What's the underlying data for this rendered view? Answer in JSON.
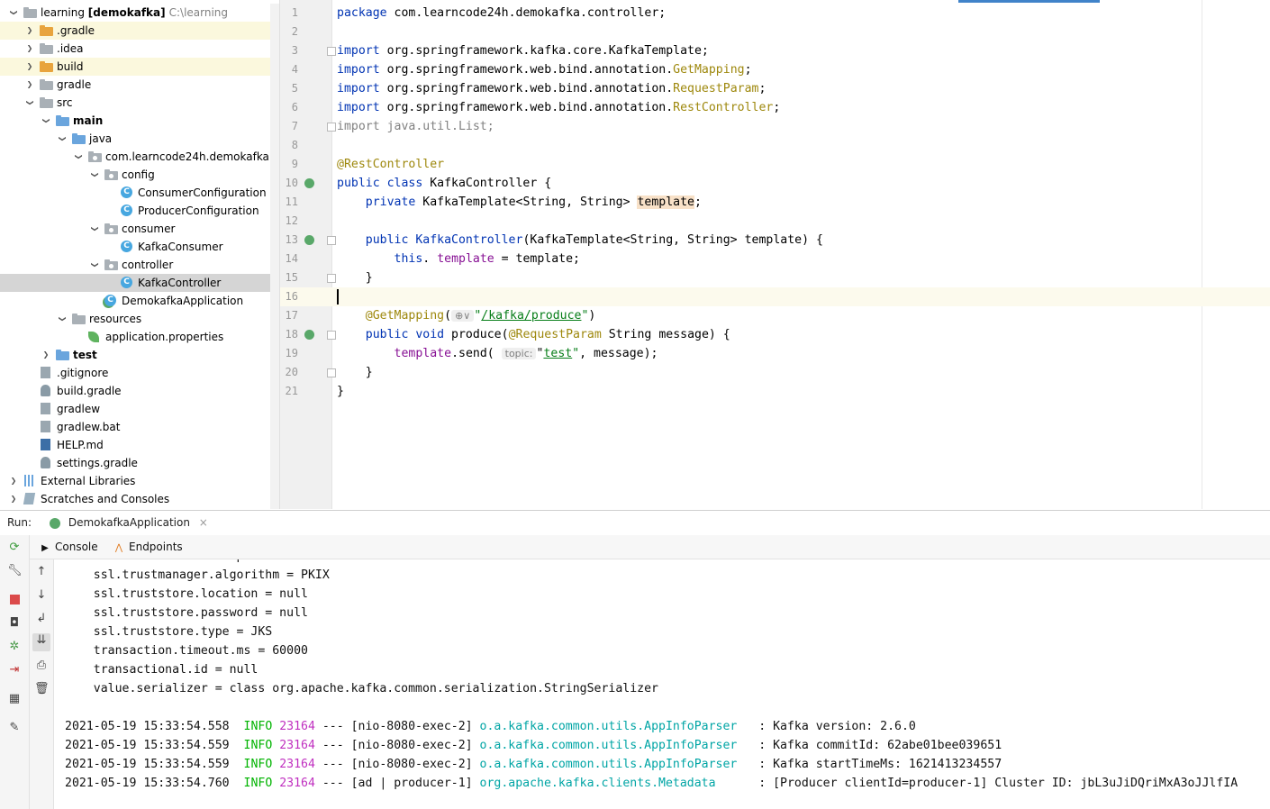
{
  "project_tree": {
    "items": [
      {
        "label": "learning [demokafka]",
        "extra": "C:\\learning",
        "icon": "module-folder-icon",
        "bold_part": true
      },
      {
        "label": ".gradle",
        "icon": "folder-icon"
      },
      {
        "label": ".idea",
        "icon": "folder-icon"
      },
      {
        "label": "build",
        "icon": "folder-icon"
      },
      {
        "label": "gradle",
        "icon": "folder-icon"
      },
      {
        "label": "src",
        "icon": "folder-icon"
      },
      {
        "label": "main",
        "icon": "source-folder-icon"
      },
      {
        "label": "java",
        "icon": "source-folder-icon"
      },
      {
        "label": "com.learncode24h.demokafka",
        "icon": "package-icon"
      },
      {
        "label": "config",
        "icon": "package-icon"
      },
      {
        "label": "ConsumerConfiguration",
        "icon": "class-icon"
      },
      {
        "label": "ProducerConfiguration",
        "icon": "class-icon"
      },
      {
        "label": "consumer",
        "icon": "package-icon"
      },
      {
        "label": "KafkaConsumer",
        "icon": "class-icon"
      },
      {
        "label": "controller",
        "icon": "package-icon"
      },
      {
        "label": "KafkaController",
        "icon": "class-icon"
      },
      {
        "label": "DemokafkaApplication",
        "icon": "spring-boot-class-icon"
      },
      {
        "label": "resources",
        "icon": "resources-folder-icon"
      },
      {
        "label": "application.properties",
        "icon": "spring-properties-icon"
      },
      {
        "label": "test",
        "icon": "source-folder-icon"
      },
      {
        "label": ".gitignore",
        "icon": "gitignore-icon"
      },
      {
        "label": "build.gradle",
        "icon": "gradle-icon"
      },
      {
        "label": "gradlew",
        "icon": "script-file-icon"
      },
      {
        "label": "gradlew.bat",
        "icon": "bat-file-icon"
      },
      {
        "label": "HELP.md",
        "icon": "markdown-icon"
      },
      {
        "label": "settings.gradle",
        "icon": "gradle-icon"
      },
      {
        "label": "External Libraries",
        "icon": "libraries-icon"
      },
      {
        "label": "Scratches and Consoles",
        "icon": "scratches-icon"
      }
    ]
  },
  "editor": {
    "lines": [
      {
        "n": "1",
        "segs": [
          [
            "kw",
            "package"
          ],
          [
            "",
            "com.learncode24h.demokafka.controller;"
          ]
        ]
      },
      {
        "n": "2",
        "segs": []
      },
      {
        "n": "3",
        "segs": [
          [
            "kw",
            "import"
          ],
          [
            "",
            "org.springframework.kafka.core.KafkaTemplate;"
          ]
        ]
      },
      {
        "n": "4",
        "segs": [
          [
            "kw",
            "import"
          ],
          [
            "",
            "org.springframework.web.bind.annotation."
          ],
          [
            "ann",
            "GetMapping"
          ],
          [
            "",
            ";"
          ]
        ]
      },
      {
        "n": "5",
        "segs": [
          [
            "kw",
            "import"
          ],
          [
            "",
            "org.springframework.web.bind.annotation."
          ],
          [
            "ann",
            "RequestParam"
          ],
          [
            "",
            ";"
          ]
        ]
      },
      {
        "n": "6",
        "segs": [
          [
            "kw",
            "import"
          ],
          [
            "",
            "org.springframework.web.bind.annotation."
          ],
          [
            "ann",
            "RestController"
          ],
          [
            "",
            ";"
          ]
        ]
      },
      {
        "n": "7",
        "segs": [
          [
            "grey",
            "import"
          ],
          [
            "grey",
            "java.util.List;"
          ]
        ]
      },
      {
        "n": "8",
        "segs": []
      },
      {
        "n": "9",
        "segs": [
          [
            "ann",
            "@RestController"
          ]
        ]
      },
      {
        "n": "10",
        "segs": [
          [
            "kw",
            "public class"
          ],
          [
            "",
            "KafkaController {"
          ]
        ]
      },
      {
        "n": "11",
        "segs": [
          [
            "",
            "    "
          ],
          [
            "kw",
            "private"
          ],
          [
            "",
            "KafkaTemplate<String, String> "
          ],
          [
            "hl",
            "template"
          ],
          [
            "",
            ";"
          ]
        ]
      },
      {
        "n": "12",
        "segs": []
      },
      {
        "n": "13",
        "segs": [
          [
            "",
            "    "
          ],
          [
            "kw",
            "public"
          ],
          [
            "kw",
            "KafkaController"
          ],
          [
            "",
            "(KafkaTemplate<String, String> template) {"
          ]
        ]
      },
      {
        "n": "14",
        "segs": [
          [
            "",
            "        "
          ],
          [
            "kw",
            "this"
          ],
          [
            "",
            ". "
          ],
          [
            "fld",
            "template"
          ],
          [
            "",
            " = template;"
          ]
        ]
      },
      {
        "n": "15",
        "segs": [
          [
            "",
            "    }"
          ]
        ]
      },
      {
        "n": "16",
        "segs": [
          [
            "caret",
            ""
          ]
        ]
      },
      {
        "n": "17",
        "segs": [
          [
            "",
            "    "
          ],
          [
            "ann",
            "@GetMapping"
          ],
          [
            "",
            "("
          ],
          [
            "hint",
            "⊕∨"
          ],
          [
            "str",
            "\""
          ],
          [
            "strl",
            "/kafka/produce"
          ],
          [
            "str",
            "\""
          ],
          [
            "",
            ")"
          ]
        ]
      },
      {
        "n": "18",
        "segs": [
          [
            "",
            "    "
          ],
          [
            "kw",
            "public void"
          ],
          [
            "",
            "produce("
          ],
          [
            "ann",
            "@RequestParam"
          ],
          [
            "",
            " String message) {"
          ]
        ]
      },
      {
        "n": "19",
        "segs": [
          [
            "",
            "        "
          ],
          [
            "fld",
            "template"
          ],
          [
            "",
            ".send( "
          ],
          [
            "hint",
            "topic:"
          ],
          [
            "",
            "\""
          ],
          [
            "strl",
            "test"
          ],
          [
            "str",
            "\""
          ],
          [
            "",
            ", message);"
          ]
        ]
      },
      {
        "n": "20",
        "segs": [
          [
            "",
            "    }"
          ]
        ]
      },
      {
        "n": "21",
        "segs": [
          [
            "",
            "}"
          ]
        ]
      }
    ]
  },
  "run": {
    "label": "Run:",
    "tab": "DemokafkaApplication",
    "console_tab": "Console",
    "endpoints_tab": "Endpoints"
  },
  "console": {
    "partial_top": "    ssl.secure.random.implementation = null",
    "config_lines": [
      "    ssl.trustmanager.algorithm = PKIX",
      "    ssl.truststore.location = null",
      "    ssl.truststore.password = null",
      "    ssl.truststore.type = JKS",
      "    transaction.timeout.ms = 60000",
      "    transactional.id = null",
      "    value.serializer = class org.apache.kafka.common.serialization.StringSerializer"
    ],
    "log_lines": [
      {
        "ts": "2021-05-19 15:33:54.558",
        "level": "INFO",
        "pid": "23164",
        "sep": "---",
        "thread": "[nio-8080-exec-2]",
        "logger": "o.a.kafka.common.utils.AppInfoParser",
        "msg": ": Kafka version: 2.6.0"
      },
      {
        "ts": "2021-05-19 15:33:54.559",
        "level": "INFO",
        "pid": "23164",
        "sep": "---",
        "thread": "[nio-8080-exec-2]",
        "logger": "o.a.kafka.common.utils.AppInfoParser",
        "msg": ": Kafka commitId: 62abe01bee039651"
      },
      {
        "ts": "2021-05-19 15:33:54.559",
        "level": "INFO",
        "pid": "23164",
        "sep": "---",
        "thread": "[nio-8080-exec-2]",
        "logger": "o.a.kafka.common.utils.AppInfoParser",
        "msg": ": Kafka startTimeMs: 1621413234557"
      },
      {
        "ts": "2021-05-19 15:33:54.760",
        "level": "INFO",
        "pid": "23164",
        "sep": "---",
        "thread": "[ad | producer-1]",
        "logger": "org.apache.kafka.clients.Metadata",
        "msg": ": [Producer clientId=producer-1] Cluster ID: jbL3uJiDQriMxA3oJJlfIA"
      }
    ]
  },
  "colors": {
    "keyword": "#0033b3",
    "annotation": "#9e880d",
    "field": "#871094",
    "string": "#067d17",
    "info": "#00b300",
    "pid": "#c030c0",
    "logger": "#00a5a5",
    "highlight_row": "#fbf8dd",
    "selected_row": "#d5d5d5"
  }
}
